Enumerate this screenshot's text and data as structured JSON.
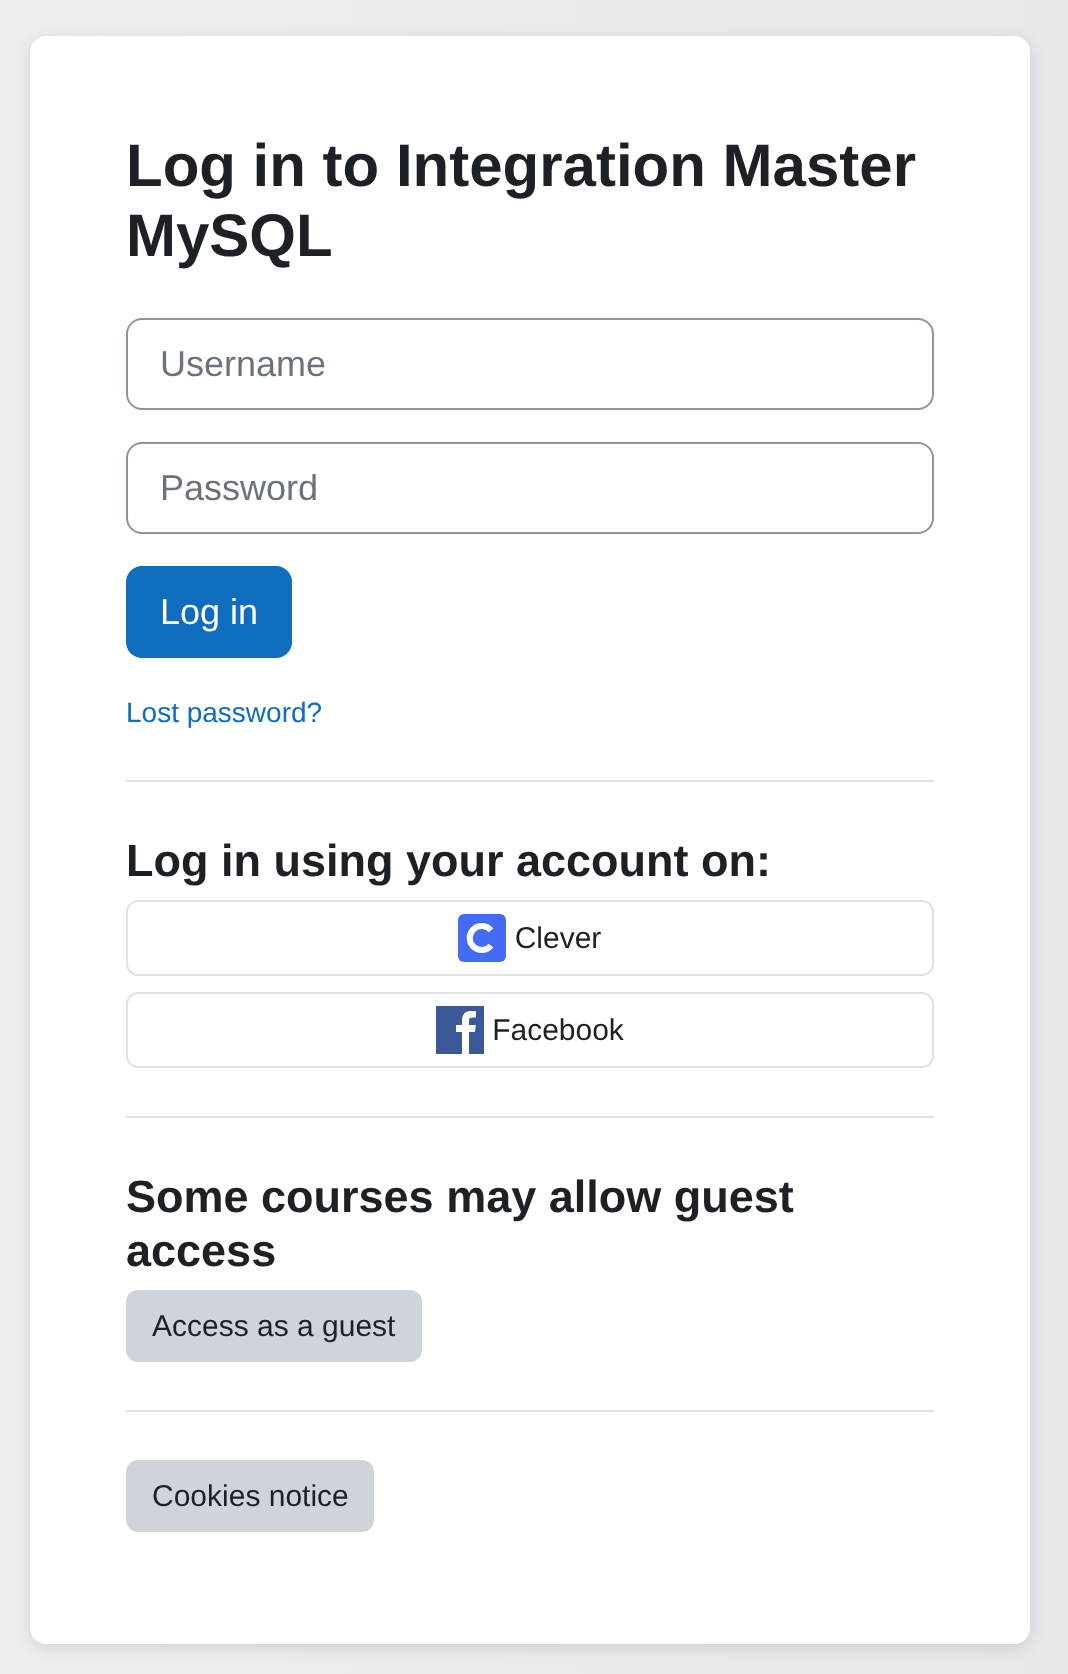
{
  "title": "Log in to Integration Master MySQL",
  "fields": [
    {
      "placeholder": "Username"
    },
    {
      "placeholder": "Password"
    }
  ],
  "login_button": "Log in",
  "lost_password": "Lost password?",
  "social": {
    "heading": "Log in using your account on:",
    "providers": [
      {
        "label": "Clever",
        "kind": "clever"
      },
      {
        "label": "Facebook",
        "kind": "facebook"
      }
    ]
  },
  "guest": {
    "heading": "Some courses may allow guest access",
    "button": "Access as a guest"
  },
  "cookies_button": "Cookies notice"
}
